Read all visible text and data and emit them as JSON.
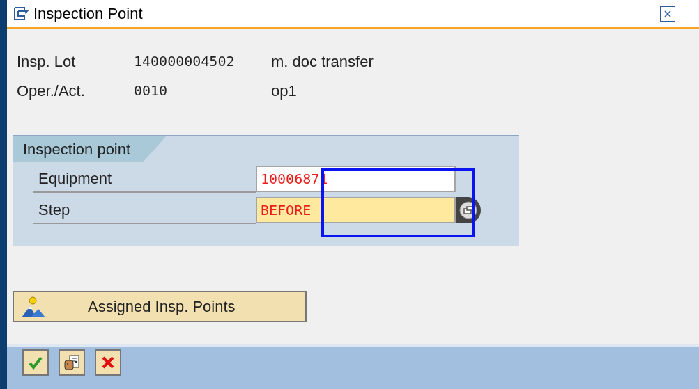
{
  "window": {
    "title": "Inspection Point"
  },
  "header_fields": [
    {
      "label": "Insp. Lot",
      "value": "140000004502",
      "description": "m. doc transfer"
    },
    {
      "label": "Oper./Act.",
      "value": "0010",
      "description": "op1"
    }
  ],
  "group": {
    "title": "Inspection point",
    "fields": [
      {
        "label": "Equipment",
        "value": "10006871",
        "focused": false,
        "value_help": false
      },
      {
        "label": "Step",
        "value": "BEFORE",
        "focused": true,
        "value_help": true
      }
    ]
  },
  "action_button": {
    "label": "Assigned Insp. Points"
  },
  "toolbar": [
    {
      "kind": "confirm"
    },
    {
      "kind": "details"
    },
    {
      "kind": "cancel"
    }
  ],
  "annotations": [
    {
      "kind": "frame"
    }
  ]
}
